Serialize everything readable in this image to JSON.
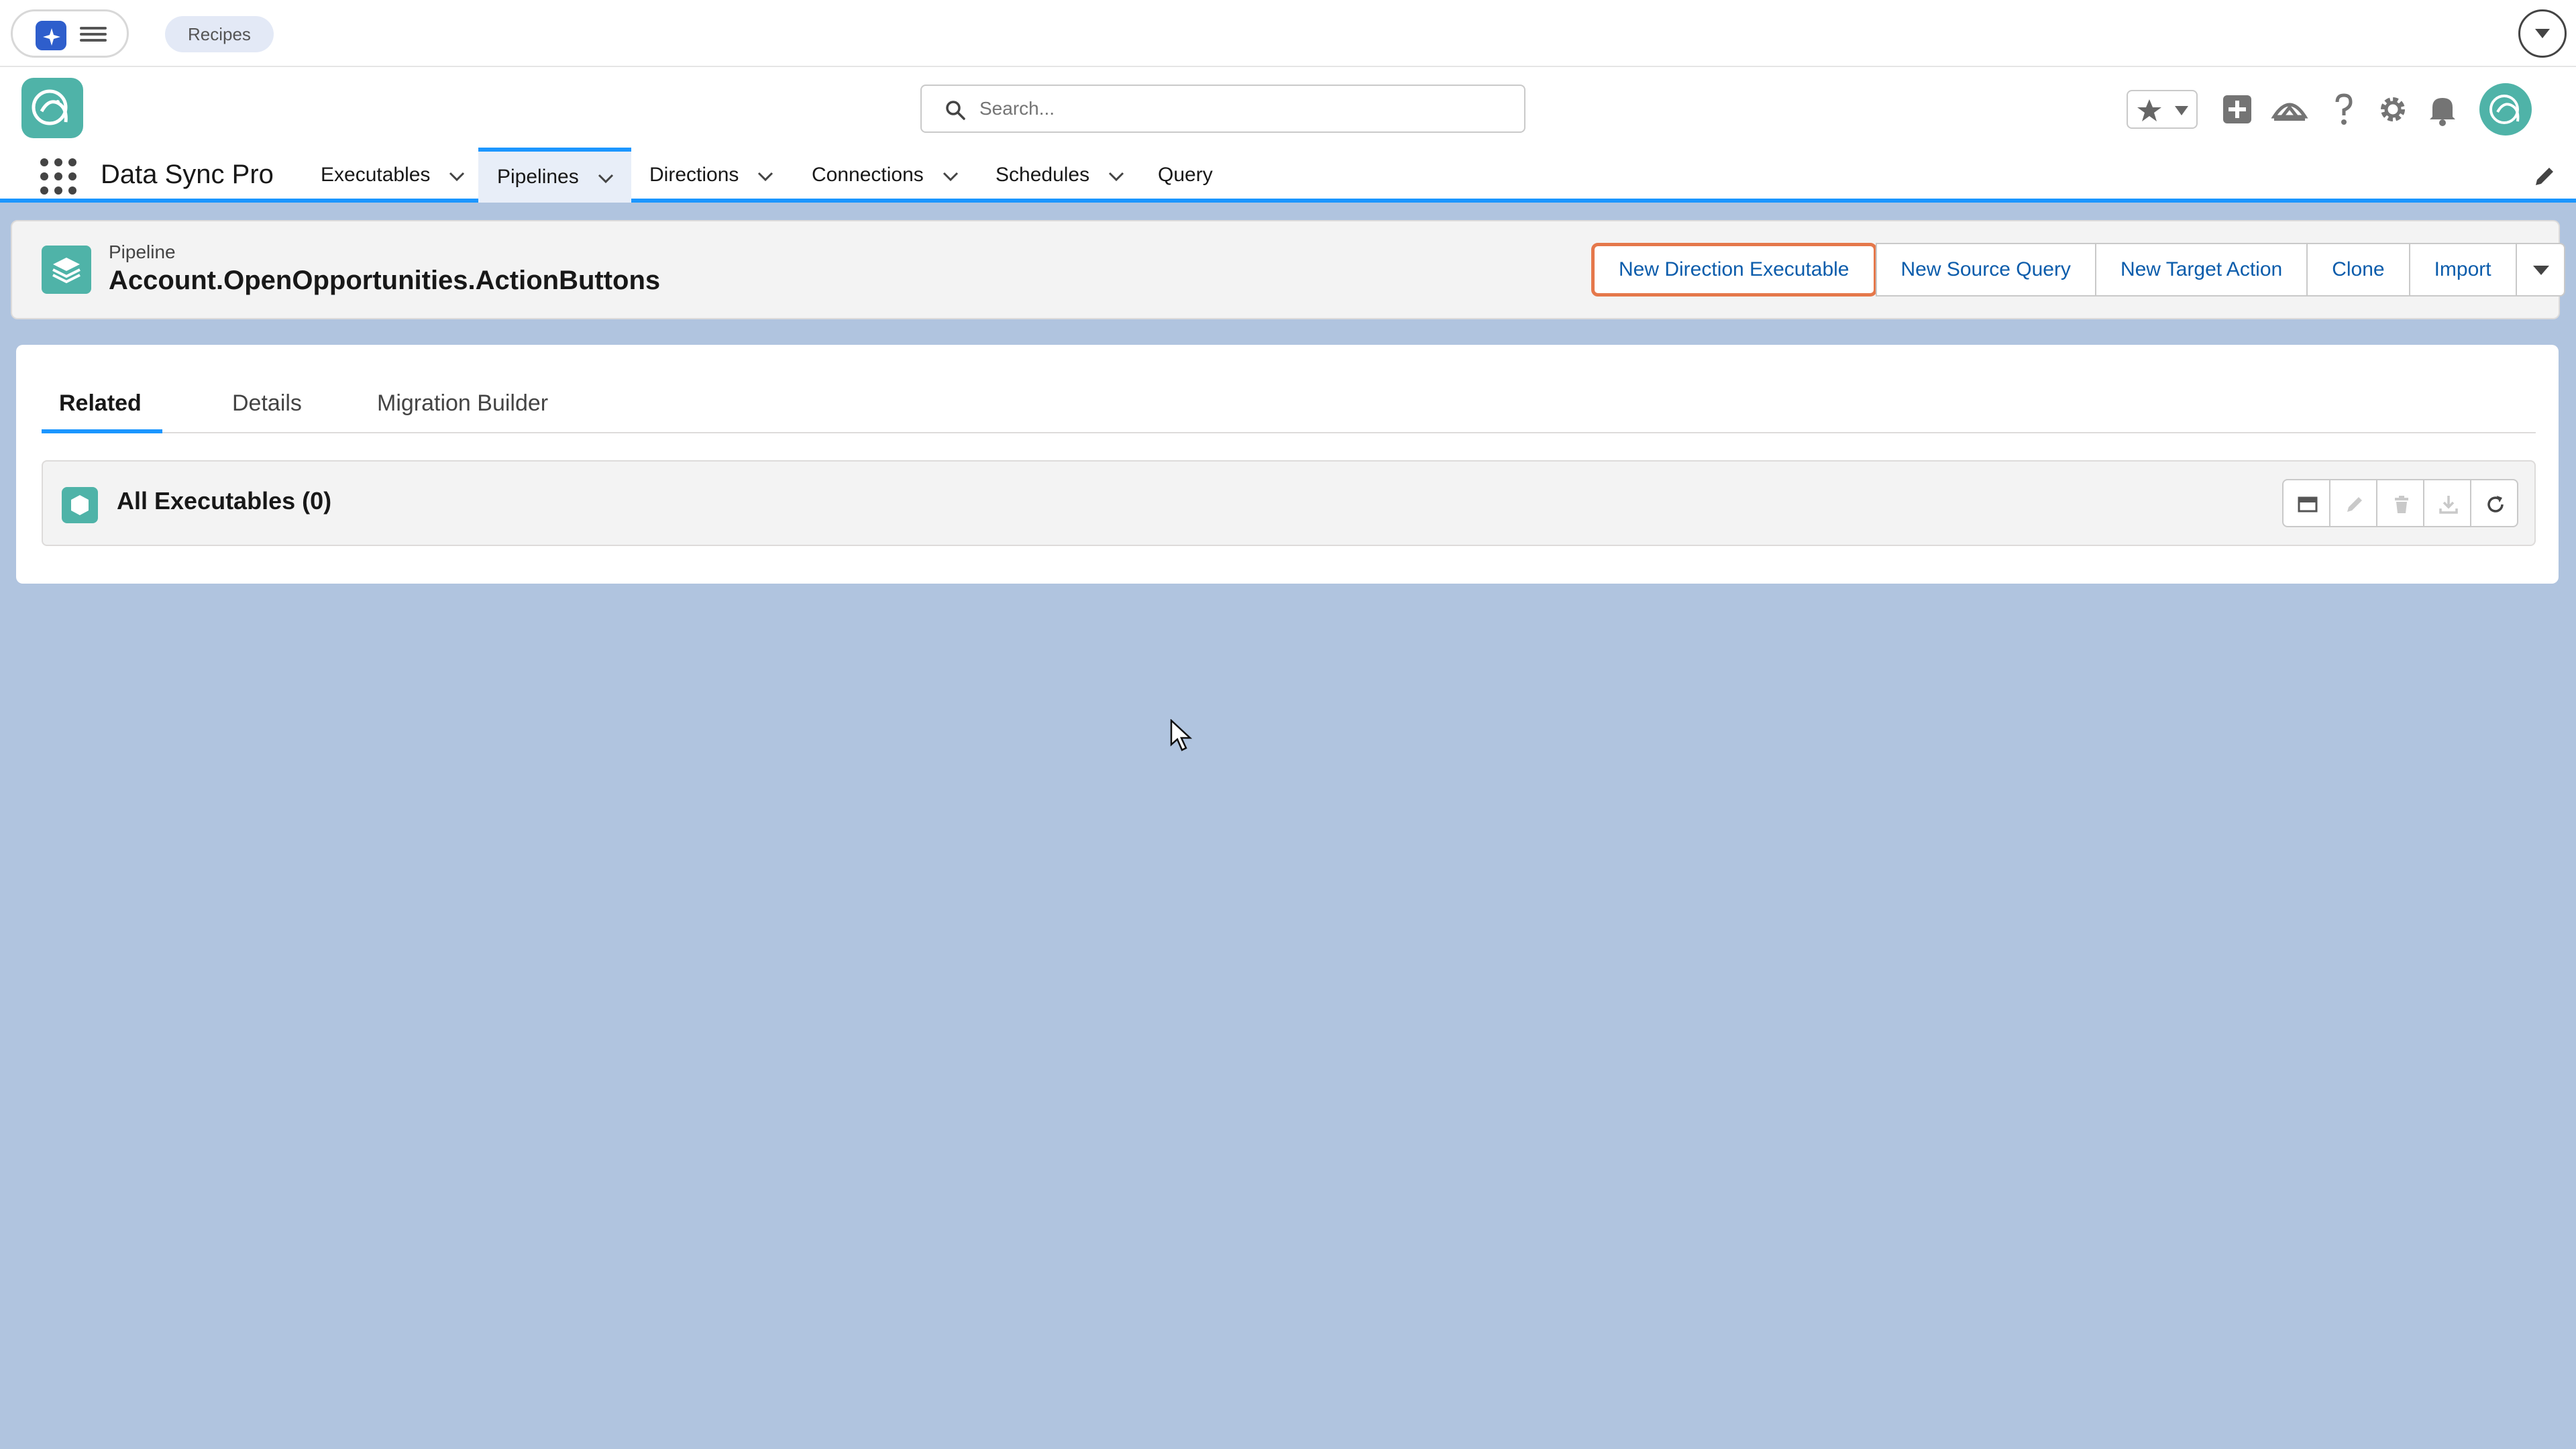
{
  "top_strip": {
    "recipes_label": "Recipes"
  },
  "header": {
    "search_placeholder": "Search...",
    "app_name": "Data Sync Pro",
    "nav": [
      {
        "label": "Executables",
        "active": false
      },
      {
        "label": "Pipelines",
        "active": true
      },
      {
        "label": "Directions",
        "active": false
      },
      {
        "label": "Connections",
        "active": false
      },
      {
        "label": "Schedules",
        "active": false
      },
      {
        "label": "Query",
        "active": false
      }
    ],
    "icons": [
      "favorites-star-icon",
      "add-icon",
      "trailhead-icon",
      "help-icon",
      "setup-gear-icon",
      "notifications-bell-icon",
      "user-avatar"
    ]
  },
  "record": {
    "object_label": "Pipeline",
    "title": "Account.OpenOpportunities.ActionButtons",
    "actions": [
      "New Direction Executable",
      "New Source Query",
      "New Target Action",
      "Clone",
      "Import"
    ],
    "highlighted_action": "New Direction Executable"
  },
  "main": {
    "tabs": [
      {
        "label": "Related",
        "active": true
      },
      {
        "label": "Details",
        "active": false
      },
      {
        "label": "Migration Builder",
        "active": false
      }
    ],
    "related_list": {
      "title": "All Executables (0)",
      "toolbar_icons": [
        "table-view-icon",
        "edit-icon",
        "delete-icon",
        "download-icon",
        "refresh-icon"
      ]
    }
  },
  "colors": {
    "brand_blue": "#1b96ff",
    "app_teal": "#4fb3a8",
    "page_background": "#b0c4df",
    "link_blue": "#0b5cab",
    "highlight_orange": "#e5784b"
  }
}
